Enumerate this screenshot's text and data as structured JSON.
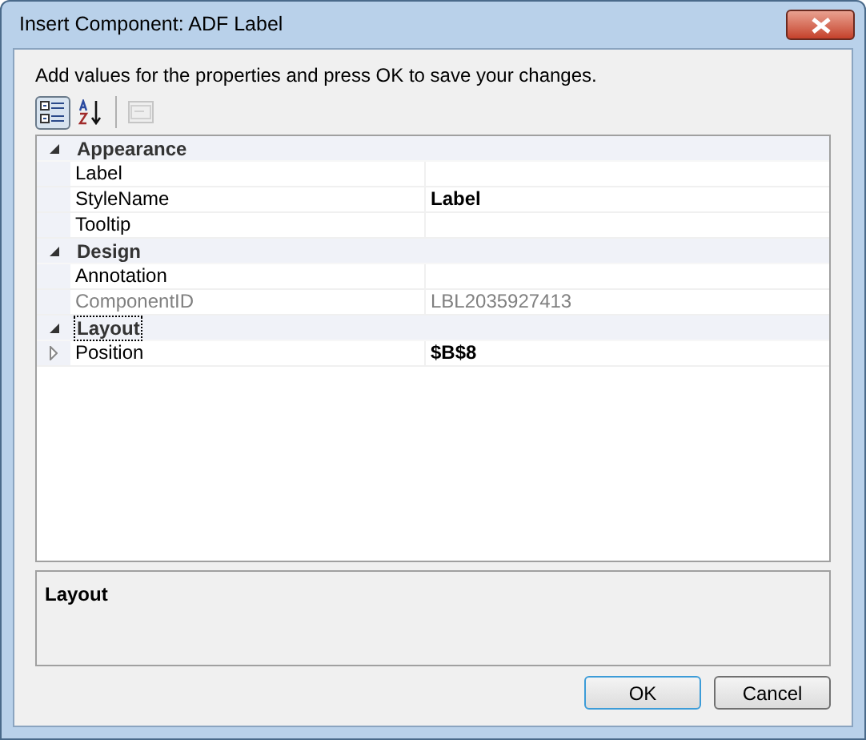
{
  "window": {
    "title": "Insert Component: ADF Label"
  },
  "instruction": "Add values for the properties and press OK to save your changes.",
  "toolbar": [
    {
      "kind": "categorized",
      "selected": true,
      "disabled": false
    },
    {
      "kind": "alphabetical",
      "selected": false,
      "disabled": false
    },
    {
      "kind": "property-pages",
      "selected": false,
      "disabled": true
    }
  ],
  "grid": {
    "categories": [
      {
        "name": "Appearance",
        "expanded": true,
        "selected": false,
        "properties": [
          {
            "name": "Label",
            "readonly": false
          },
          {
            "name": "StyleName",
            "value": "Label",
            "modified": true,
            "readonly": false
          },
          {
            "name": "Tooltip",
            "readonly": false
          }
        ]
      },
      {
        "name": "Design",
        "expanded": true,
        "selected": false,
        "properties": [
          {
            "name": "Annotation",
            "readonly": false
          },
          {
            "name": "ComponentID",
            "value": "LBL2035927413",
            "modified": false,
            "readonly": true
          }
        ]
      },
      {
        "name": "Layout",
        "expanded": true,
        "selected": true,
        "properties": [
          {
            "name": "Position",
            "value": "$B$8",
            "modified": true,
            "readonly": false,
            "expanded": false
          }
        ]
      }
    ]
  },
  "description": {
    "title": "Layout"
  },
  "buttons": [
    {
      "label": "OK",
      "default": true
    },
    {
      "label": "Cancel",
      "default": false
    }
  ]
}
